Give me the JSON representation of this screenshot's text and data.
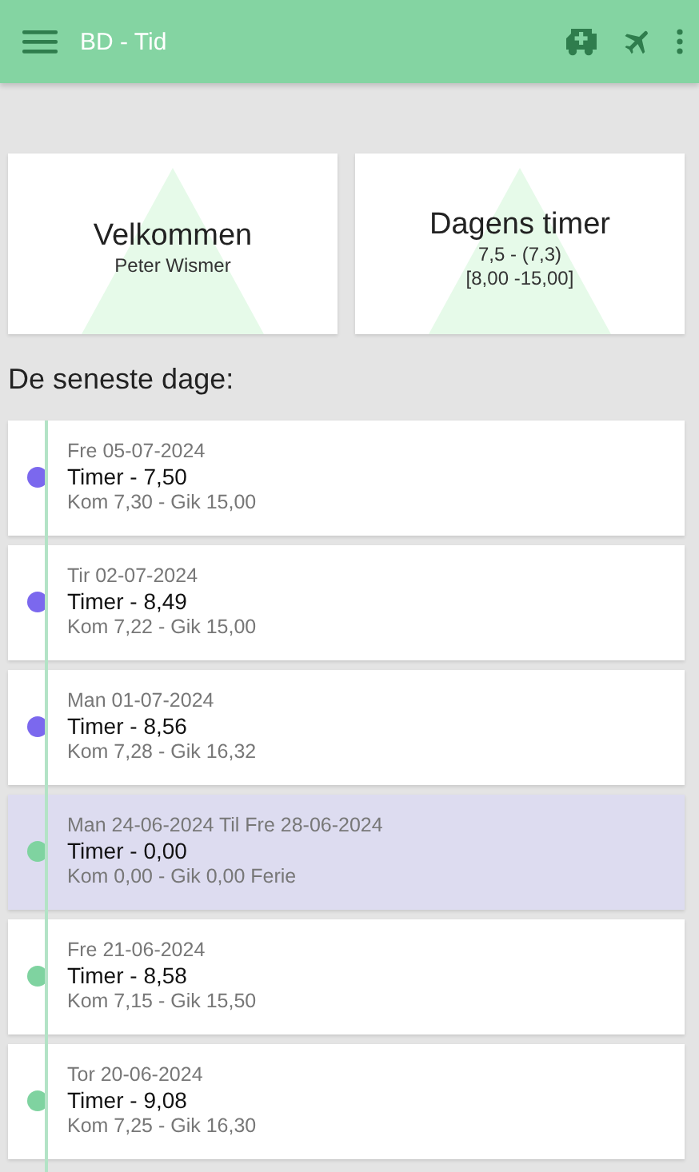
{
  "app_bar": {
    "title": "BD - Tid"
  },
  "cards": [
    {
      "title": "Velkommen",
      "lines": [
        "Peter Wismer"
      ]
    },
    {
      "title": "Dagens timer",
      "lines": [
        "7,5 - (7,3)",
        "[8,00 -15,00]"
      ]
    }
  ],
  "section_heading": "De seneste dage:",
  "days": [
    {
      "date": "Fre 05-07-2024",
      "hours": "Timer - 7,50",
      "times": "Kom 7,30 - Gik 15,00",
      "color": "#7b68ee",
      "highlighted": false
    },
    {
      "date": "Tir 02-07-2024",
      "hours": "Timer - 8,49",
      "times": "Kom 7,22 - Gik 15,00",
      "color": "#7b68ee",
      "highlighted": false
    },
    {
      "date": "Man 01-07-2024",
      "hours": "Timer - 8,56",
      "times": "Kom 7,28 - Gik 16,32",
      "color": "#7b68ee",
      "highlighted": false
    },
    {
      "date": "Man 24-06-2024 Til Fre 28-06-2024",
      "hours": "Timer - 0,00",
      "times": "Kom 0,00 - Gik 0,00 Ferie",
      "color": "#7fd3a0",
      "highlighted": true
    },
    {
      "date": "Fre 21-06-2024",
      "hours": "Timer - 8,58",
      "times": "Kom 7,15 - Gik 15,50",
      "color": "#7fd3a0",
      "highlighted": false
    },
    {
      "date": "Tor 20-06-2024",
      "hours": "Timer - 9,08",
      "times": "Kom 7,25 - Gik 16,30",
      "color": "#7fd3a0",
      "highlighted": false
    }
  ]
}
